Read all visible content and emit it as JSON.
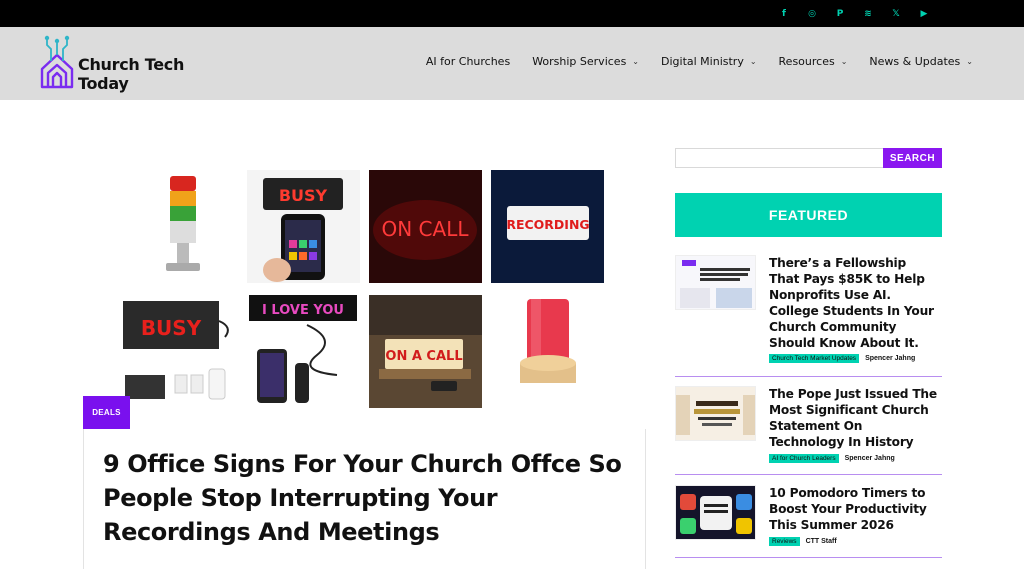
{
  "topbar": {
    "social": [
      {
        "icon": "facebook-icon",
        "glyph": "f"
      },
      {
        "icon": "instagram-icon",
        "glyph": "◎"
      },
      {
        "icon": "pinterest-icon",
        "glyph": "P"
      },
      {
        "icon": "rss-icon",
        "glyph": "≋"
      },
      {
        "icon": "x-icon",
        "glyph": "𝕏"
      },
      {
        "icon": "youtube-icon",
        "glyph": "▶"
      }
    ],
    "accent": "#00d2b1"
  },
  "header": {
    "logo_line1": "Church Tech",
    "logo_line2": "Today",
    "nav": [
      {
        "label": "AI for Churches",
        "caret": false
      },
      {
        "label": "Worship Services",
        "caret": true
      },
      {
        "label": "Digital Ministry",
        "caret": true
      },
      {
        "label": "Resources",
        "caret": true
      },
      {
        "label": "News & Updates",
        "caret": true
      }
    ]
  },
  "main": {
    "hero_images": [
      {
        "name": "tower-light"
      },
      {
        "name": "busy-phone-sign",
        "text": "BUSY"
      },
      {
        "name": "on-call-neon",
        "text": "ON CALL"
      },
      {
        "name": "recording-sign",
        "text": "RECORDING"
      },
      {
        "name": "busy-box-sign",
        "text": "BUSY"
      },
      {
        "name": "led-scroll-sign",
        "text": "I LOVE YOU"
      },
      {
        "name": "on-a-call-sign",
        "text": "ON A CALL"
      },
      {
        "name": "red-lamp"
      }
    ],
    "category_badge": "DEALS",
    "headline": "9 Office Signs For Your Church Offce So People Stop Interrupting Your Recordings And Meetings"
  },
  "sidebar": {
    "search_placeholder": "",
    "search_button": "SEARCH",
    "featured_label": "FEATURED",
    "posts": [
      {
        "title": "There’s a Fellowship That Pays $85K to Help Nonprofits Use AI. College Students In Your Church Community Should Know About It.",
        "category": "Church Tech Market Updates",
        "author": "Spencer Jahng"
      },
      {
        "title": "The Pope Just Issued The Most Significant Church Statement On Technology In History",
        "category": "AI for Church Leaders",
        "author": "Spencer Jahng"
      },
      {
        "title": "10 Pomodoro Timers to Boost Your Productivity This Summer 2026",
        "category": "Reviews",
        "author": "CTT Staff"
      }
    ]
  }
}
